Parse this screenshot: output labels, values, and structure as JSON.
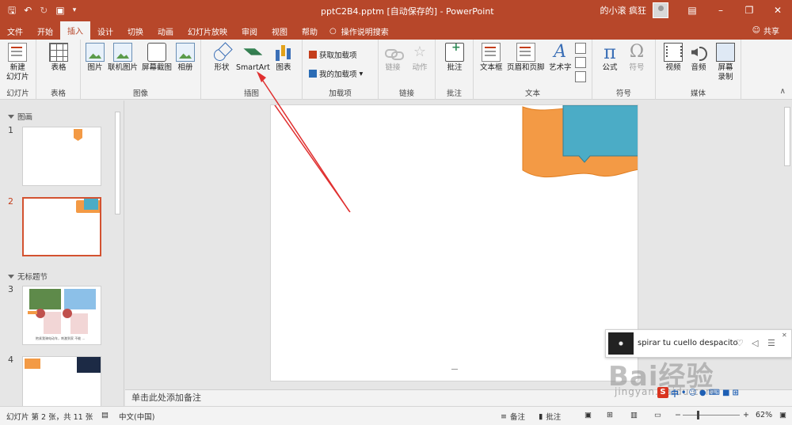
{
  "titlebar": {
    "filename": "pptC2B4.pptm [自动保存的]",
    "separator": " - ",
    "app": "PowerPoint",
    "user": "的小滚 疯狂",
    "qat_icons": [
      "save-icon",
      "undo-icon",
      "redo-icon",
      "present-icon",
      "customize-icon"
    ],
    "window_controls": [
      "ribbon-display-icon",
      "minimize-icon",
      "restore-icon",
      "close-icon"
    ]
  },
  "tabs": [
    "文件",
    "开始",
    "插入",
    "设计",
    "切换",
    "动画",
    "幻灯片放映",
    "审阅",
    "视图",
    "帮助"
  ],
  "active_tab": "插入",
  "tell_me": "操作说明搜索",
  "share": "共享",
  "ribbon": {
    "groups": {
      "slides": "幻灯片",
      "tables": "表格",
      "images": "图像",
      "illustrations": "插图",
      "addins": "加载项",
      "links": "链接",
      "comments": "批注",
      "text": "文本",
      "symbols": "符号",
      "media": "媒体"
    },
    "buttons": {
      "new_slide": "新建",
      "new_slide_2": "幻灯片",
      "table": "表格",
      "picture": "图片",
      "online_picture": "联机图片",
      "screenshot": "屏幕截图",
      "album": "相册",
      "shapes": "形状",
      "smartart": "SmartArt",
      "chart": "图表",
      "get_addins": "获取加载项",
      "my_addins": "我的加载项",
      "link": "链接",
      "action": "动作",
      "comment": "批注",
      "textbox": "文本框",
      "header_footer": "页眉和页脚",
      "wordart": "艺术字",
      "equation": "公式",
      "symbol": "符号",
      "video": "视频",
      "audio": "音频",
      "screen_rec": "屏幕",
      "screen_rec_2": "录制"
    }
  },
  "thumbnails": {
    "section1": "图画",
    "section2": "无标题节",
    "slides": [
      {
        "num": "1"
      },
      {
        "num": "2"
      },
      {
        "num": "3",
        "caption": "抱紧我骑电动车，刺激到家 不能 ..."
      },
      {
        "num": "4"
      }
    ]
  },
  "notes_placeholder": "单击此处添加备注",
  "statusbar": {
    "slide_info": "幻灯片 第 2 张，共 11 张",
    "language": "中文(中国)",
    "notes": "备注",
    "comments": "批注",
    "zoom": "62%"
  },
  "music": {
    "song": "spirar tu cuello despacito"
  },
  "watermark": {
    "text": "Bai经验",
    "url": "jingyan.baidu.com"
  },
  "ime": {
    "lang": "中"
  },
  "colors": {
    "accent": "#b7472a",
    "selection": "#d35230",
    "banner_orange": "#f39a45",
    "banner_blue": "#4bacc6"
  }
}
